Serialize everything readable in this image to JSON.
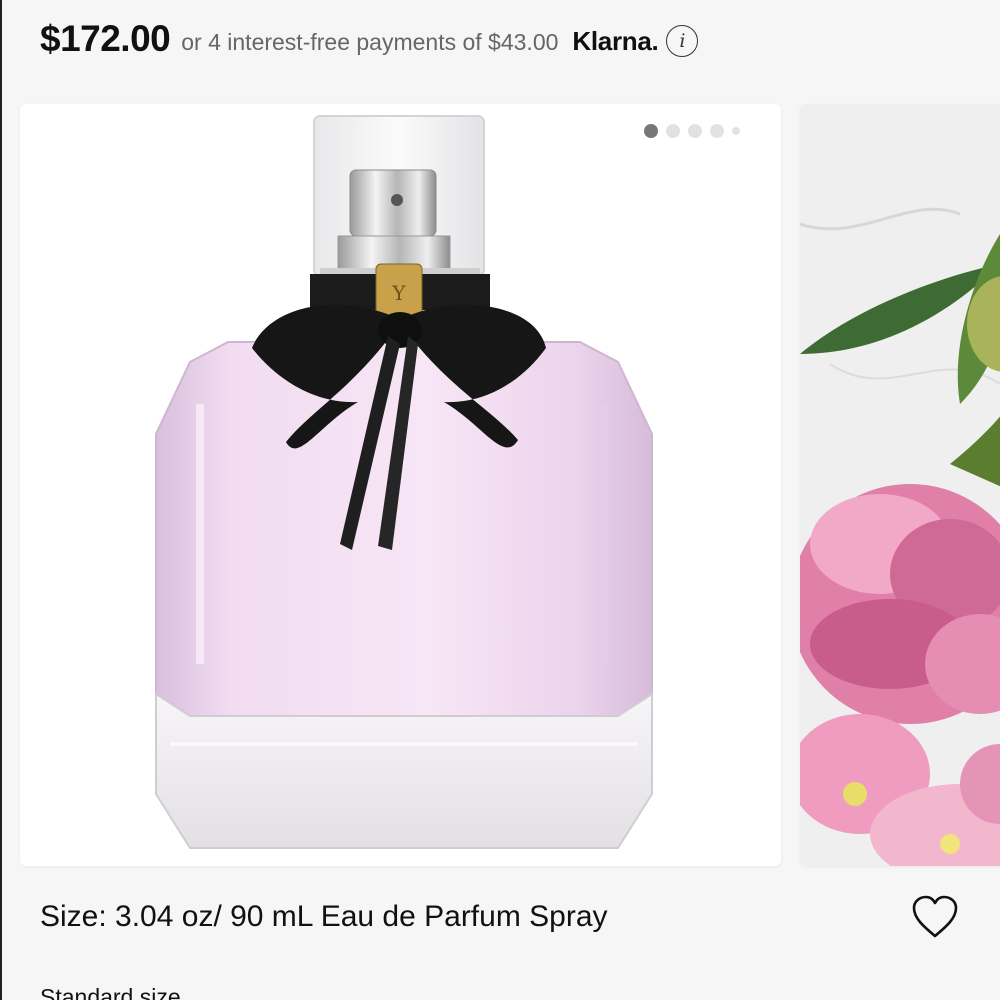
{
  "price": {
    "amount": "$172.00",
    "installments_text": "or 4 interest-free payments of $43.00",
    "provider": "Klarna.",
    "info_icon": "info-icon"
  },
  "carousel": {
    "slide_count": 5,
    "active_index": 0,
    "main_image": "perfume-bottle-image",
    "next_image": "peony-flowers-image"
  },
  "size": {
    "label": "Size: 3.04 oz/ 90 mL Eau de Parfum Spray",
    "favorite_icon": "heart-icon"
  },
  "size_option": {
    "label": "Standard size"
  },
  "colors": {
    "text": "#111111",
    "muted": "#666666",
    "bottle_pink": "#eed6ee",
    "dot_active": "#777777",
    "dot_inactive": "#e2e2e2"
  }
}
